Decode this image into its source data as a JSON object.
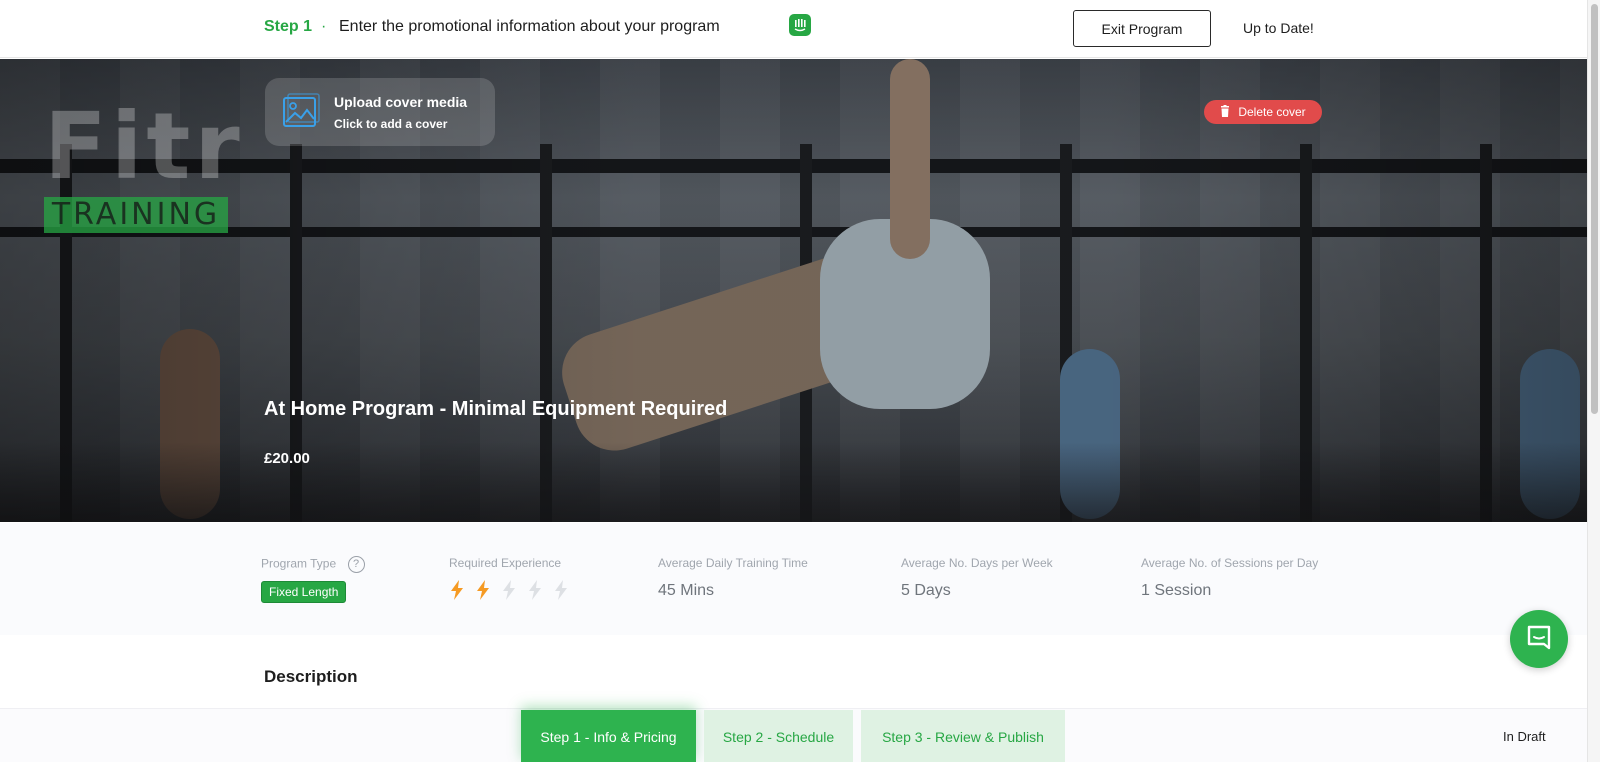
{
  "header": {
    "step_label": "Step 1",
    "step_dot": "·",
    "step_description": "Enter the promotional information about your program",
    "exit_button": "Exit Program",
    "save_status": "Up to Date!"
  },
  "hero": {
    "logo_word": "Fitr",
    "logo_sub": "TRAINING",
    "upload_title": "Upload cover media",
    "upload_subtitle": "Click to add a cover",
    "delete_button": "Delete cover",
    "program_title": "At Home Program - Minimal Equipment Required",
    "program_price": "£20.00"
  },
  "stats": {
    "program_type_label": "Program Type",
    "program_type_help": "?",
    "program_type_value": "Fixed Length",
    "experience_label": "Required Experience",
    "experience_level": 2,
    "experience_max": 5,
    "daily_time_label": "Average Daily Training Time",
    "daily_time_value": "45 Mins",
    "days_per_week_label": "Average No. Days per Week",
    "days_per_week_value": "5 Days",
    "sessions_label": "Average No. of Sessions per Day",
    "sessions_value": "1 Session"
  },
  "description": {
    "heading": "Description"
  },
  "stepper": {
    "step1": "Step 1 - Info & Pricing",
    "step2": "Step 2 - Schedule",
    "step3": "Step 3 - Review & Publish",
    "status": "In Draft"
  },
  "colors": {
    "brand_green": "#27a744",
    "delete_red": "#e14b4b",
    "bolt_active": "#f59a23",
    "bolt_inactive": "#dde0e4"
  },
  "icons": {
    "intercom": "intercom-icon",
    "upload": "image-upload-icon",
    "trash": "trash-icon",
    "help": "help-circle-icon",
    "bolt": "lightning-bolt-icon",
    "chat": "chat-icon"
  }
}
